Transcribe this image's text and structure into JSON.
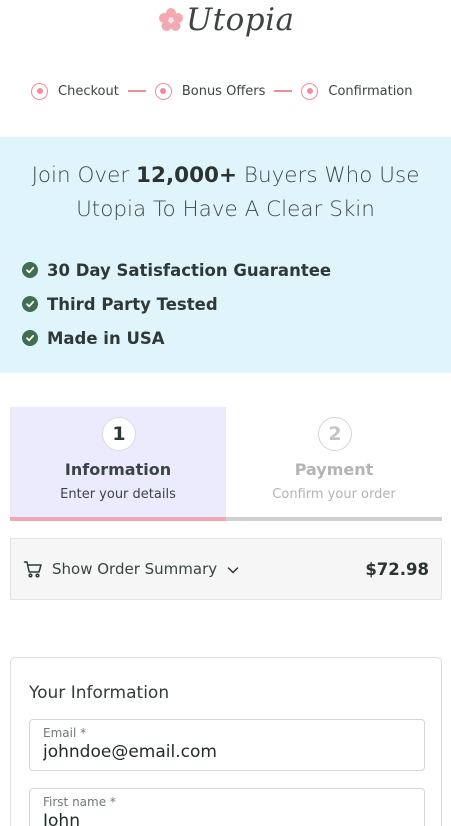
{
  "brand": {
    "name": "Utopia",
    "accent_color": "#ef8e98"
  },
  "progress": {
    "steps": [
      "Checkout",
      "Bonus Offers",
      "Confirmation"
    ]
  },
  "banner": {
    "title_prefix": "Join Over ",
    "title_bold": "12,000+",
    "title_suffix": " Buyers Who Use Utopia To Have A Clear Skin",
    "background_color": "#e0f5fb",
    "benefits": [
      "30 Day Satisfaction Guarantee",
      "Third Party Tested",
      "Made in USA"
    ],
    "check_icon": "check-circle-icon",
    "check_color": "#3f6e52"
  },
  "checkout_steps": [
    {
      "number": "1",
      "title": "Information",
      "subtitle": "Enter your details",
      "active": true
    },
    {
      "number": "2",
      "title": "Payment",
      "subtitle": "Confirm your order",
      "active": false
    }
  ],
  "order_summary": {
    "label": "Show Order Summary",
    "price": "$72.98",
    "icon": "cart-icon",
    "toggle_icon": "chevron-down-icon"
  },
  "your_information": {
    "title": "Your Information",
    "email": {
      "label": "Email *",
      "value": "johndoe@email.com"
    },
    "first_name": {
      "label": "First name *",
      "value": "John"
    }
  }
}
